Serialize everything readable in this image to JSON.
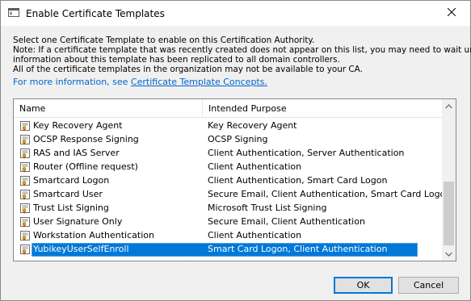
{
  "window": {
    "title": "Enable Certificate Templates",
    "icon": "dialog-window-icon"
  },
  "description": {
    "lines": [
      "Select one Certificate Template to enable on this Certification Authority.",
      "Note: If a certificate template that was recently created does not appear on this list, you may need to wait until",
      "information about this template has been replicated to all domain controllers.",
      "All of the certificate templates in the organization may not be available to your CA."
    ],
    "link_prefix": "For more information, see ",
    "link_text": "Certificate Template Concepts."
  },
  "list": {
    "columns": [
      "Name",
      "Intended Purpose"
    ],
    "row_icon": "certificate-template-icon",
    "rows": [
      {
        "name": "Key Recovery Agent",
        "purpose": "Key Recovery Agent"
      },
      {
        "name": "OCSP Response Signing",
        "purpose": "OCSP Signing"
      },
      {
        "name": "RAS and IAS Server",
        "purpose": "Client Authentication, Server Authentication"
      },
      {
        "name": "Router (Offline request)",
        "purpose": "Client Authentication"
      },
      {
        "name": "Smartcard Logon",
        "purpose": "Client Authentication, Smart Card Logon"
      },
      {
        "name": "Smartcard User",
        "purpose": "Secure Email, Client Authentication, Smart Card Logon"
      },
      {
        "name": "Trust List Signing",
        "purpose": "Microsoft Trust List Signing"
      },
      {
        "name": "User Signature Only",
        "purpose": "Secure Email, Client Authentication"
      },
      {
        "name": "Workstation Authentication",
        "purpose": "Client Authentication"
      },
      {
        "name": "YubikeyUserSelfEnroll",
        "purpose": "Smart Card Logon, Client Authentication",
        "selected": true
      }
    ]
  },
  "buttons": {
    "ok": "OK",
    "cancel": "Cancel"
  },
  "colors": {
    "selection": "#0078d7",
    "link": "#0066cc",
    "default_button_border": "#0078d7"
  }
}
